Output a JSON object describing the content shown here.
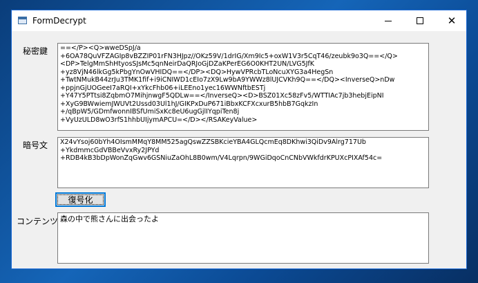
{
  "window": {
    "title": "FormDecrypt",
    "min_icon": "minimize-icon",
    "max_icon": "maximize-icon",
    "close_icon": "close-icon",
    "close_glyph": "✕"
  },
  "private_key": {
    "label": "秘密鍵",
    "value": "==</P><Q>wweDSpJ/a\n+6OA78QuVFZAGIp8vBZZIP01rFN3HJpz//OKz59V/1drIG/Xm9Ic5+oxW1V3r5CqT46/zeubk9o3Q==</Q>\n<DP>TelgMmShHtyosSJsMc5qnNeirDaQRJoGjDZaKPerEG6O0KHT2UN/LVG5JfK\n+yz8VjN46lkGg5kPbgYnOwVHIDQ==</DP><DQ>HywVPRcbTLoNcuXYG3a4HegSn\n+TwtNMukB44zrJu3TMK1fif+i9iCNIWD1cEIo7zX9Lw9bA9YWWz8lUJCVKh9Q==</DQ><InverseQ>nDw\n+ppjnGjUOGeeI7aRQI+xYkcFhb06+iLEEno1yec16WWNftbESTj\n+Y47Y5PTtsi8ZqbmO7MihjnwgF5QDLw==</InverseQ><D>BSZ01Xc58zFv5/WTTIAc7jb3hebjEipNI\n+XyG9BWwiemJWUVt2Ussd03Ul1hJ/GIKPxDuP671iBbxKCFXcxurB5hbB7GqkzIn\n+/qBpW5/GDmfwonnIBSfUmiSxKc8eU6ugGjlIYqpiTen8j\n+VyUzULD8wO3rfS1hhbUIjymAPCU=</D></RSAKeyValue>"
  },
  "ciphertext": {
    "label": "暗号文",
    "value": "X24vYsoj60bYh4OIsmMMqY8MM525agQswZZSBKcieYBA4GLQcmEq8DKhwi3QiDv9Alrg717Ub\n+YkdmmcGdVBBeVvxRy2JPYd\n+RDB4kB3bDpWonZqGwv6GSNiuZaOhL8B0wm/V4Lqrpn/9WGiDqoCnCNbVWkfdrKPUXcPIXAf54c="
  },
  "decrypt_button": {
    "label": "復号化"
  },
  "content": {
    "label": "コンテンツ",
    "value": "森の中で熊さんに出会ったよ"
  }
}
